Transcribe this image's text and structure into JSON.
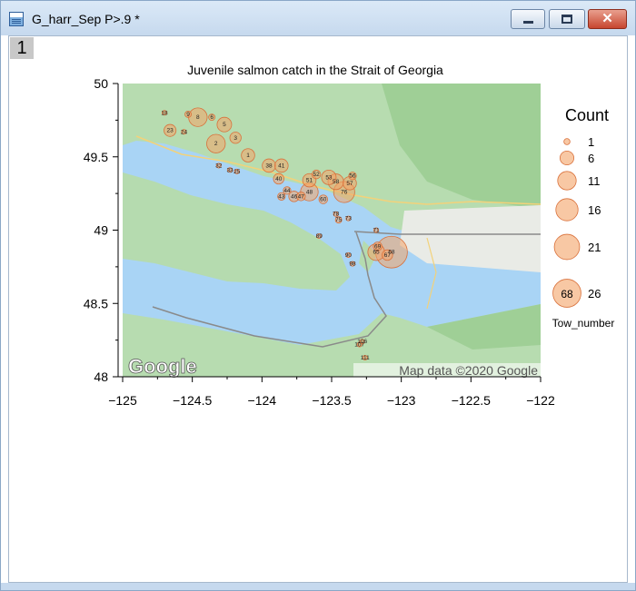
{
  "window": {
    "title": "G_harr_Sep P>.9 *",
    "page_tab": "1",
    "buttons": [
      "minimize",
      "maximize",
      "close"
    ],
    "close_glyph": "✕"
  },
  "map": {
    "attribution": "Map data ©2020 Google",
    "logo": "Google"
  },
  "chart_data": {
    "type": "scatter",
    "title": "Juvenile salmon catch in the Strait of Georgia",
    "xlim": [
      -125,
      -122
    ],
    "ylim": [
      48,
      50
    ],
    "xticks": [
      -125,
      -124.5,
      -124,
      -123.5,
      -123,
      -122.5,
      -122
    ],
    "xtick_labels": [
      "−125",
      "−124.5",
      "−124",
      "−123.5",
      "−123",
      "−122.5",
      "−122"
    ],
    "yticks": [
      48,
      48.5,
      49,
      49.5,
      50
    ],
    "ytick_labels": [
      "48",
      "48.5",
      "49",
      "49.5",
      "50"
    ],
    "legend": {
      "title": "Count",
      "entries": [
        {
          "label": "1",
          "count": 1
        },
        {
          "label": "6",
          "count": 6
        },
        {
          "label": "11",
          "count": 11
        },
        {
          "label": "16",
          "count": 16
        },
        {
          "label": "21",
          "count": 21
        },
        {
          "label": "26",
          "count": 26
        }
      ],
      "example_label": "68",
      "label_caption": "Tow_number",
      "placement": "right"
    },
    "points": [
      {
        "tow": "18",
        "lon": -124.7,
        "lat": 49.8,
        "count": 1
      },
      {
        "tow": "9",
        "lon": -124.53,
        "lat": 49.79,
        "count": 2
      },
      {
        "tow": "23",
        "lon": -124.66,
        "lat": 49.68,
        "count": 8
      },
      {
        "tow": "24",
        "lon": -124.56,
        "lat": 49.67,
        "count": 1
      },
      {
        "tow": "8",
        "lon": -124.46,
        "lat": 49.77,
        "count": 20
      },
      {
        "tow": "6",
        "lon": -124.36,
        "lat": 49.77,
        "count": 2
      },
      {
        "tow": "5",
        "lon": -124.27,
        "lat": 49.72,
        "count": 12
      },
      {
        "tow": "3",
        "lon": -124.19,
        "lat": 49.63,
        "count": 7
      },
      {
        "tow": "2",
        "lon": -124.33,
        "lat": 49.59,
        "count": 20
      },
      {
        "tow": "1",
        "lon": -124.1,
        "lat": 49.51,
        "count": 10
      },
      {
        "tow": "32",
        "lon": -124.31,
        "lat": 49.44,
        "count": 1
      },
      {
        "tow": "33",
        "lon": -124.23,
        "lat": 49.41,
        "count": 1
      },
      {
        "tow": "25",
        "lon": -124.18,
        "lat": 49.4,
        "count": 1
      },
      {
        "tow": "38",
        "lon": -123.95,
        "lat": 49.44,
        "count": 10
      },
      {
        "tow": "41",
        "lon": -123.86,
        "lat": 49.44,
        "count": 10
      },
      {
        "tow": "40",
        "lon": -123.88,
        "lat": 49.35,
        "count": 6
      },
      {
        "tow": "44",
        "lon": -123.82,
        "lat": 49.27,
        "count": 3
      },
      {
        "tow": "43",
        "lon": -123.86,
        "lat": 49.23,
        "count": 3
      },
      {
        "tow": "46",
        "lon": -123.77,
        "lat": 49.23,
        "count": 6
      },
      {
        "tow": "47",
        "lon": -123.72,
        "lat": 49.23,
        "count": 4
      },
      {
        "tow": "48",
        "lon": -123.66,
        "lat": 49.26,
        "count": 18
      },
      {
        "tow": "51",
        "lon": -123.66,
        "lat": 49.34,
        "count": 10
      },
      {
        "tow": "52",
        "lon": -123.61,
        "lat": 49.38,
        "count": 4
      },
      {
        "tow": "60",
        "lon": -123.56,
        "lat": 49.21,
        "count": 4
      },
      {
        "tow": "53",
        "lon": -123.52,
        "lat": 49.36,
        "count": 12
      },
      {
        "tow": "58",
        "lon": -123.47,
        "lat": 49.33,
        "count": 14
      },
      {
        "tow": "56",
        "lon": -123.35,
        "lat": 49.37,
        "count": 3
      },
      {
        "tow": "57",
        "lon": -123.37,
        "lat": 49.32,
        "count": 10
      },
      {
        "tow": "76",
        "lon": -123.41,
        "lat": 49.26,
        "count": 26
      },
      {
        "tow": "78",
        "lon": -123.47,
        "lat": 49.11,
        "count": 1
      },
      {
        "tow": "75",
        "lon": -123.45,
        "lat": 49.07,
        "count": 2
      },
      {
        "tow": "73",
        "lon": -123.38,
        "lat": 49.08,
        "count": 1
      },
      {
        "tow": "89",
        "lon": -123.59,
        "lat": 48.96,
        "count": 1
      },
      {
        "tow": "71",
        "lon": -123.18,
        "lat": 49.0,
        "count": 1
      },
      {
        "tow": "69",
        "lon": -123.17,
        "lat": 48.89,
        "count": 4
      },
      {
        "tow": "65",
        "lon": -123.18,
        "lat": 48.85,
        "count": 16
      },
      {
        "tow": "68",
        "lon": -123.07,
        "lat": 48.85,
        "count": 60
      },
      {
        "tow": "67",
        "lon": -123.1,
        "lat": 48.83,
        "count": 6
      },
      {
        "tow": "90",
        "lon": -123.38,
        "lat": 48.83,
        "count": 1
      },
      {
        "tow": "98",
        "lon": -123.35,
        "lat": 48.77,
        "count": 1
      },
      {
        "tow": "106",
        "lon": -123.28,
        "lat": 48.24,
        "count": 1
      },
      {
        "tow": "107",
        "lon": -123.3,
        "lat": 48.22,
        "count": 1
      },
      {
        "tow": "111",
        "lon": -123.26,
        "lat": 48.13,
        "count": 1
      }
    ]
  }
}
